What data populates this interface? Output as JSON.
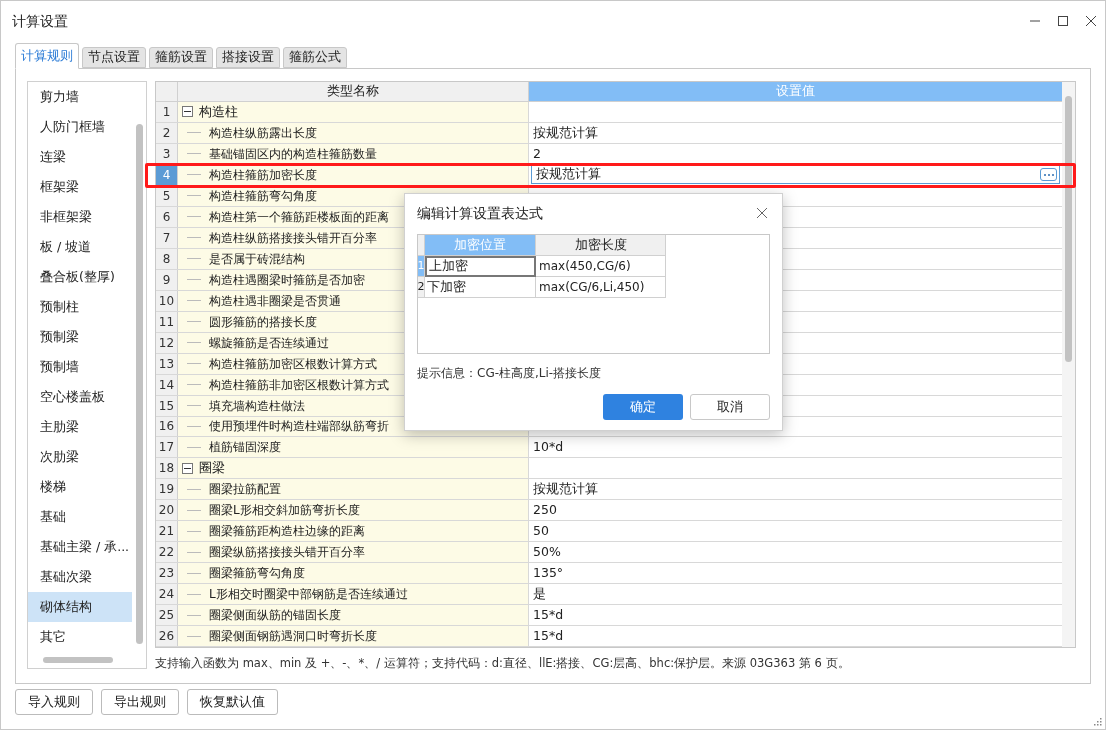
{
  "window": {
    "title": "计算设置"
  },
  "tabs": [
    {
      "label": "计算规则",
      "selected": true
    },
    {
      "label": "节点设置",
      "selected": false
    },
    {
      "label": "箍筋设置",
      "selected": false
    },
    {
      "label": "搭接设置",
      "selected": false
    },
    {
      "label": "箍筋公式",
      "selected": false
    }
  ],
  "sidebar": {
    "items": [
      {
        "label": "剪力墙",
        "selected": false
      },
      {
        "label": "人防门框墙",
        "selected": false
      },
      {
        "label": "连梁",
        "selected": false
      },
      {
        "label": "框架梁",
        "selected": false
      },
      {
        "label": "非框架梁",
        "selected": false
      },
      {
        "label": "板 / 坡道",
        "selected": false
      },
      {
        "label": "叠合板(整厚)",
        "selected": false
      },
      {
        "label": "预制柱",
        "selected": false
      },
      {
        "label": "预制梁",
        "selected": false
      },
      {
        "label": "预制墙",
        "selected": false
      },
      {
        "label": "空心楼盖板",
        "selected": false
      },
      {
        "label": "主肋梁",
        "selected": false
      },
      {
        "label": "次肋梁",
        "selected": false
      },
      {
        "label": "楼梯",
        "selected": false
      },
      {
        "label": "基础",
        "selected": false
      },
      {
        "label": "基础主梁 / 承...",
        "selected": false
      },
      {
        "label": "基础次梁",
        "selected": false
      },
      {
        "label": "砌体结构",
        "selected": true
      },
      {
        "label": "其它",
        "selected": false
      }
    ]
  },
  "table": {
    "columns": [
      {
        "label": "类型名称",
        "selected": false
      },
      {
        "label": "设置值",
        "selected": true
      }
    ],
    "rows": [
      {
        "no": "1",
        "kind": "group",
        "expanded": true,
        "name": "构造柱",
        "selected": false
      },
      {
        "no": "2",
        "kind": "item",
        "name": "构造柱纵筋露出长度",
        "value": "按规范计算",
        "selected": false
      },
      {
        "no": "3",
        "kind": "item",
        "name": "基础锚固区内的构造柱箍筋数量",
        "value": "2",
        "selected": false
      },
      {
        "no": "4",
        "kind": "item",
        "name": "构造柱箍筋加密长度",
        "value": "按规范计算",
        "selected": true
      },
      {
        "no": "5",
        "kind": "item",
        "name": "构造柱箍筋弯勾角度",
        "selected": false
      },
      {
        "no": "6",
        "kind": "item",
        "name": "构造柱第一个箍筋距楼板面的距离",
        "selected": false
      },
      {
        "no": "7",
        "kind": "item",
        "name": "构造柱纵筋搭接接头错开百分率",
        "selected": false
      },
      {
        "no": "8",
        "kind": "item",
        "name": "是否属于砖混结构",
        "selected": false
      },
      {
        "no": "9",
        "kind": "item",
        "name": "构造柱遇圈梁时箍筋是否加密",
        "selected": false
      },
      {
        "no": "10",
        "kind": "item",
        "name": "构造柱遇非圈梁是否贯通",
        "selected": false
      },
      {
        "no": "11",
        "kind": "item",
        "name": "圆形箍筋的搭接长度",
        "selected": false
      },
      {
        "no": "12",
        "kind": "item",
        "name": "螺旋箍筋是否连续通过",
        "selected": false
      },
      {
        "no": "13",
        "kind": "item",
        "name": "构造柱箍筋加密区根数计算方式",
        "selected": false
      },
      {
        "no": "14",
        "kind": "item",
        "name": "构造柱箍筋非加密区根数计算方式",
        "selected": false
      },
      {
        "no": "15",
        "kind": "item",
        "name": "填充墙构造柱做法",
        "selected": false
      },
      {
        "no": "16",
        "kind": "item",
        "name": "使用预埋件时构造柱端部纵筋弯折",
        "selected": false
      },
      {
        "no": "17",
        "kind": "item",
        "name": "植筋锚固深度",
        "value": "10*d",
        "selected": false
      },
      {
        "no": "18",
        "kind": "group",
        "expanded": true,
        "name": "圈梁",
        "selected": false
      },
      {
        "no": "19",
        "kind": "item",
        "name": "圈梁拉筋配置",
        "value": "按规范计算",
        "selected": false
      },
      {
        "no": "20",
        "kind": "item",
        "name": "圈梁L形相交斜加筋弯折长度",
        "value": "250",
        "selected": false
      },
      {
        "no": "21",
        "kind": "item",
        "name": "圈梁箍筋距构造柱边缘的距离",
        "value": "50",
        "selected": false
      },
      {
        "no": "22",
        "kind": "item",
        "name": "圈梁纵筋搭接接头错开百分率",
        "value": "50%",
        "selected": false
      },
      {
        "no": "23",
        "kind": "item",
        "name": "圈梁箍筋弯勾角度",
        "value": "135°",
        "selected": false
      },
      {
        "no": "24",
        "kind": "item",
        "name": "L形相交时圈梁中部钢筋是否连续通过",
        "value": "是",
        "selected": false
      },
      {
        "no": "25",
        "kind": "item",
        "name": "圈梁侧面纵筋的锚固长度",
        "value": "15*d",
        "selected": false
      },
      {
        "no": "26",
        "kind": "item",
        "name": "圈梁侧面钢筋遇洞口时弯折长度",
        "value": "15*d",
        "selected": false
      }
    ]
  },
  "note": "支持输入函数为 max、min 及 +、-、*、/ 运算符；支持代码：d:直径、llE:搭接、CG:层高、bhc:保护层。来源 03G363 第 6 页。",
  "buttons": [
    "导入规则",
    "导出规则",
    "恢复默认值"
  ],
  "dialog": {
    "title": "编辑计算设置表达式",
    "columns": [
      {
        "label": "加密位置",
        "selected": true
      },
      {
        "label": "加密长度",
        "selected": false
      }
    ],
    "rows": [
      {
        "no": "1",
        "position": "上加密",
        "length": "max(450,CG/6)",
        "selected": true
      },
      {
        "no": "2",
        "position": "下加密",
        "length": "max(CG/6,Li,450)",
        "selected": false
      }
    ],
    "hint": "提示信息：CG-柱高度,Li-搭接长度",
    "buttons": [
      {
        "label": "确定",
        "kind": "primary"
      },
      {
        "label": "取消",
        "kind": "secondary"
      }
    ]
  }
}
